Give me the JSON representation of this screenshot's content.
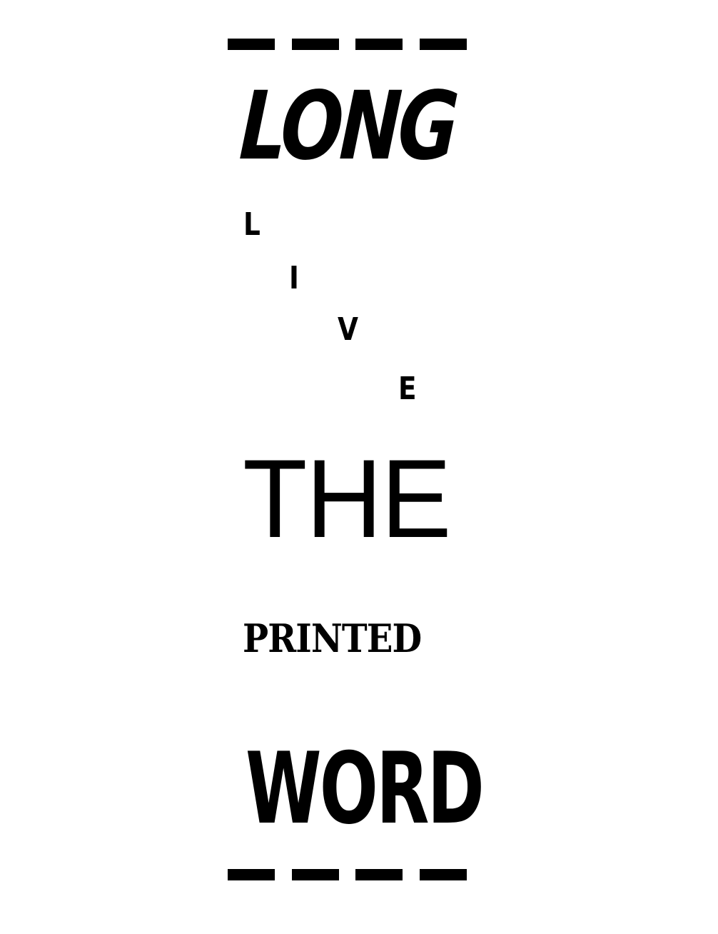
{
  "poster": {
    "line1": "LONG",
    "live_letters": [
      "L",
      "I",
      "V",
      "E"
    ],
    "line3": "THE",
    "line4": "PRINTED",
    "line5": "WORD"
  }
}
